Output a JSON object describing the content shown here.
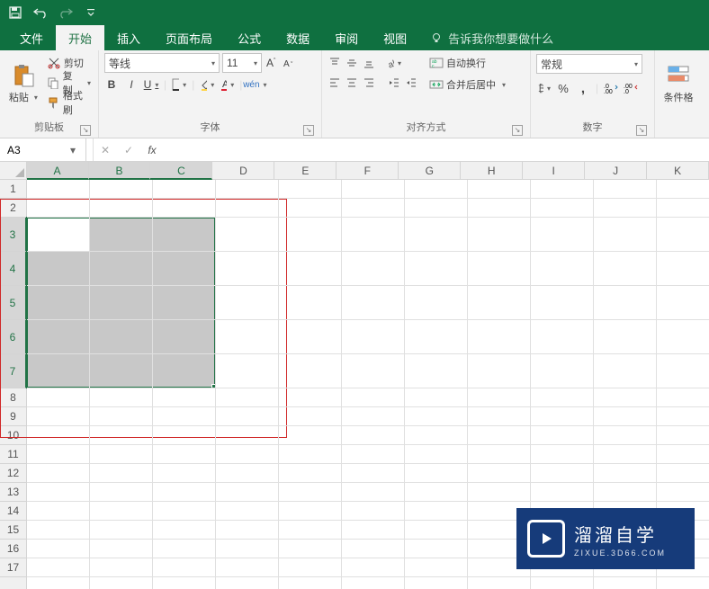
{
  "qat": {
    "save": "save",
    "undo": "undo",
    "redo": "redo"
  },
  "tabs": {
    "file": "文件",
    "home": "开始",
    "insert": "插入",
    "layout": "页面布局",
    "formula": "公式",
    "data": "数据",
    "review": "审阅",
    "view": "视图"
  },
  "tell_me": "告诉我你想要做什么",
  "ribbon": {
    "clipboard": {
      "paste": "粘贴",
      "cut": "剪切",
      "copy": "复制",
      "format_painter": "格式刷",
      "label": "剪贴板"
    },
    "font": {
      "name": "等线",
      "size": "11",
      "bold": "B",
      "italic": "I",
      "underline": "U",
      "phonetic": "wén",
      "label": "字体"
    },
    "alignment": {
      "wrap": "自动换行",
      "merge": "合并后居中",
      "label": "对齐方式"
    },
    "number": {
      "format": "常规",
      "label": "数字"
    },
    "styles": {
      "cond_fmt": "条件格"
    }
  },
  "name_box": "A3",
  "columns": [
    "A",
    "B",
    "C",
    "D",
    "E",
    "F",
    "G",
    "H",
    "I",
    "J",
    "K"
  ],
  "rows_normal_first": "1",
  "rows_normal_second": "2",
  "rows_tall": [
    "3",
    "4",
    "5",
    "6",
    "7"
  ],
  "rows_after": [
    "8",
    "9",
    "10",
    "11",
    "12",
    "13",
    "14",
    "15",
    "16",
    "17"
  ],
  "watermark": {
    "main": "溜溜自学",
    "sub": "ZIXUE.3D66.COM"
  }
}
